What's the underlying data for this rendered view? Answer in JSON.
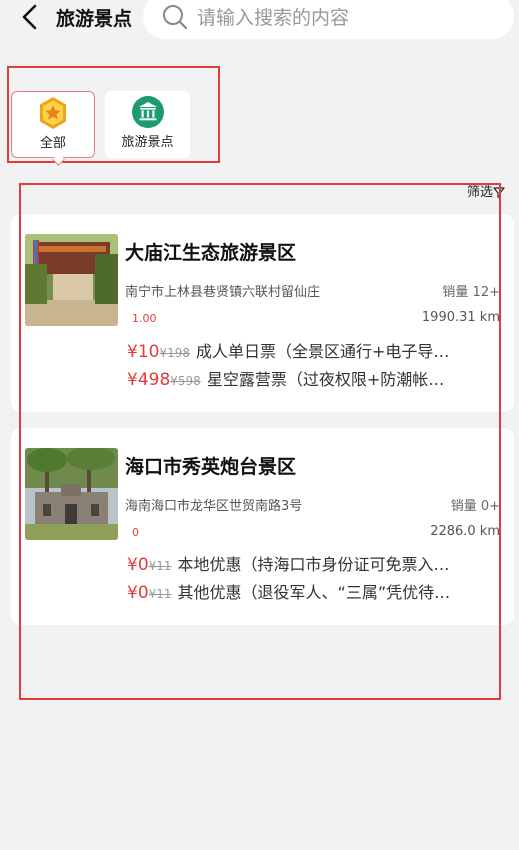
{
  "header": {
    "title": "旅游景点",
    "search_placeholder": "请输入搜索的内容"
  },
  "categories": [
    {
      "label": "全部",
      "icon": "star-badge-icon",
      "active": true
    },
    {
      "label": "旅游景点",
      "icon": "museum-icon",
      "active": false
    }
  ],
  "filter": {
    "label": "筛选"
  },
  "spots": [
    {
      "name": "大庙江生态旅游景区",
      "address": "南宁市上林县巷贤镇六联村留仙庄",
      "sales": "销量 12+",
      "score": "1.00",
      "distance": "1990.31 km",
      "tickets": [
        {
          "price": "¥10",
          "original": "¥198",
          "name": "成人单日票（全景区通行+电子导…"
        },
        {
          "price": "¥498",
          "original": "¥598",
          "name": "星空露营票（过夜权限+防潮帐…"
        }
      ]
    },
    {
      "name": "海口市秀英炮台景区",
      "address": "海南海口市龙华区世贸南路3号",
      "sales": "销量 0+",
      "score": "0",
      "distance": "2286.0 km",
      "tickets": [
        {
          "price": "¥0",
          "original": "¥11",
          "name": "本地优惠（持海口市身份证可免票入…"
        },
        {
          "price": "¥0",
          "original": "¥11",
          "name": "其他优惠（退役军人、“三属”凭优待…"
        }
      ]
    }
  ],
  "colors": {
    "accent": "#e03c3c",
    "icon_green": "#1a9c6e",
    "badge_orange": "#f2a21a"
  }
}
